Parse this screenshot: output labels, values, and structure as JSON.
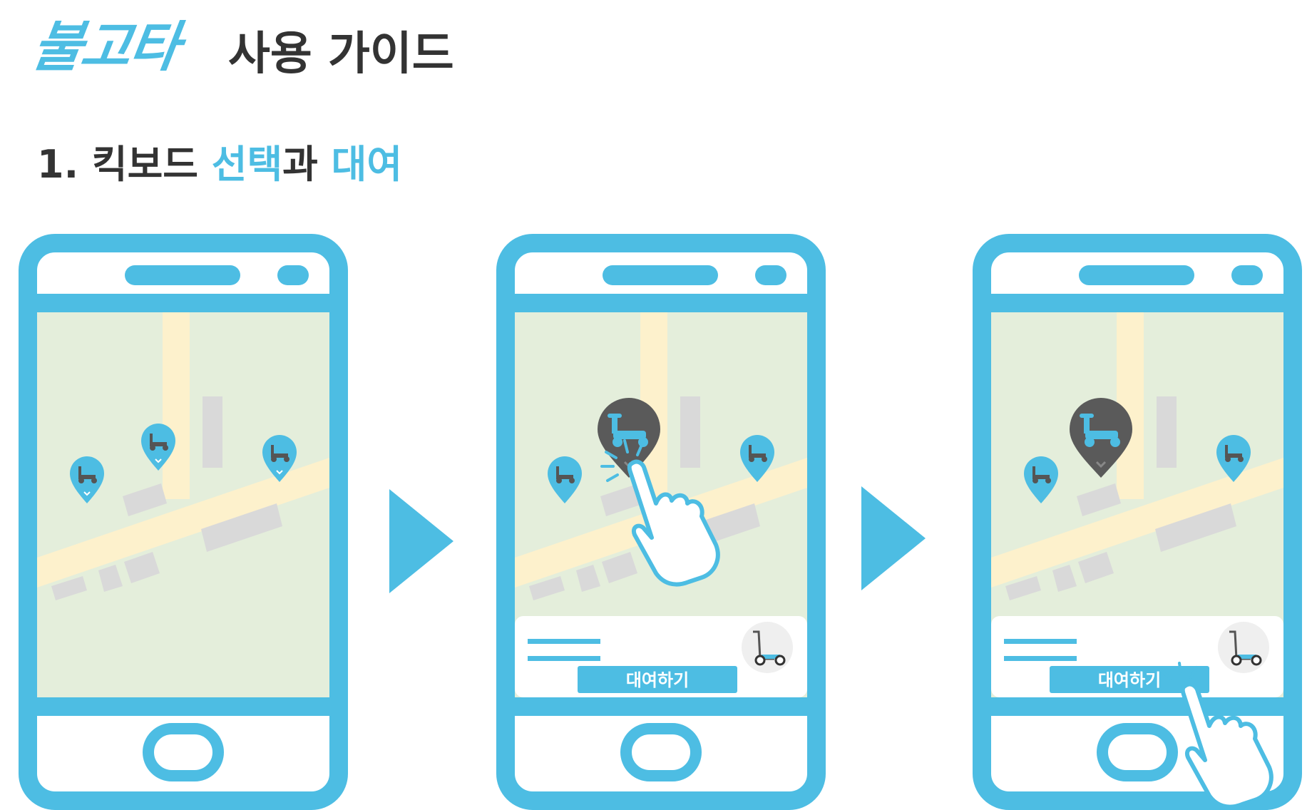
{
  "header": {
    "logo_text": "불고타",
    "guide_title": "사용 가이드"
  },
  "step": {
    "number": "1.",
    "part1": "킥보드",
    "highlight1": "선택",
    "part2": "과",
    "highlight2": "대여"
  },
  "phones": [
    {
      "state": "map"
    },
    {
      "state": "scooter-selected",
      "rent_button": "대여하기"
    },
    {
      "state": "rent-tapped",
      "rent_button": "대여하기"
    }
  ],
  "colors": {
    "accent": "#4dbde3",
    "map_bg": "#e4eedb",
    "road": "#fdf1cc",
    "building": "#d9d9d9",
    "pin_selected": "#5a5a5a",
    "text_dark": "#333333"
  }
}
